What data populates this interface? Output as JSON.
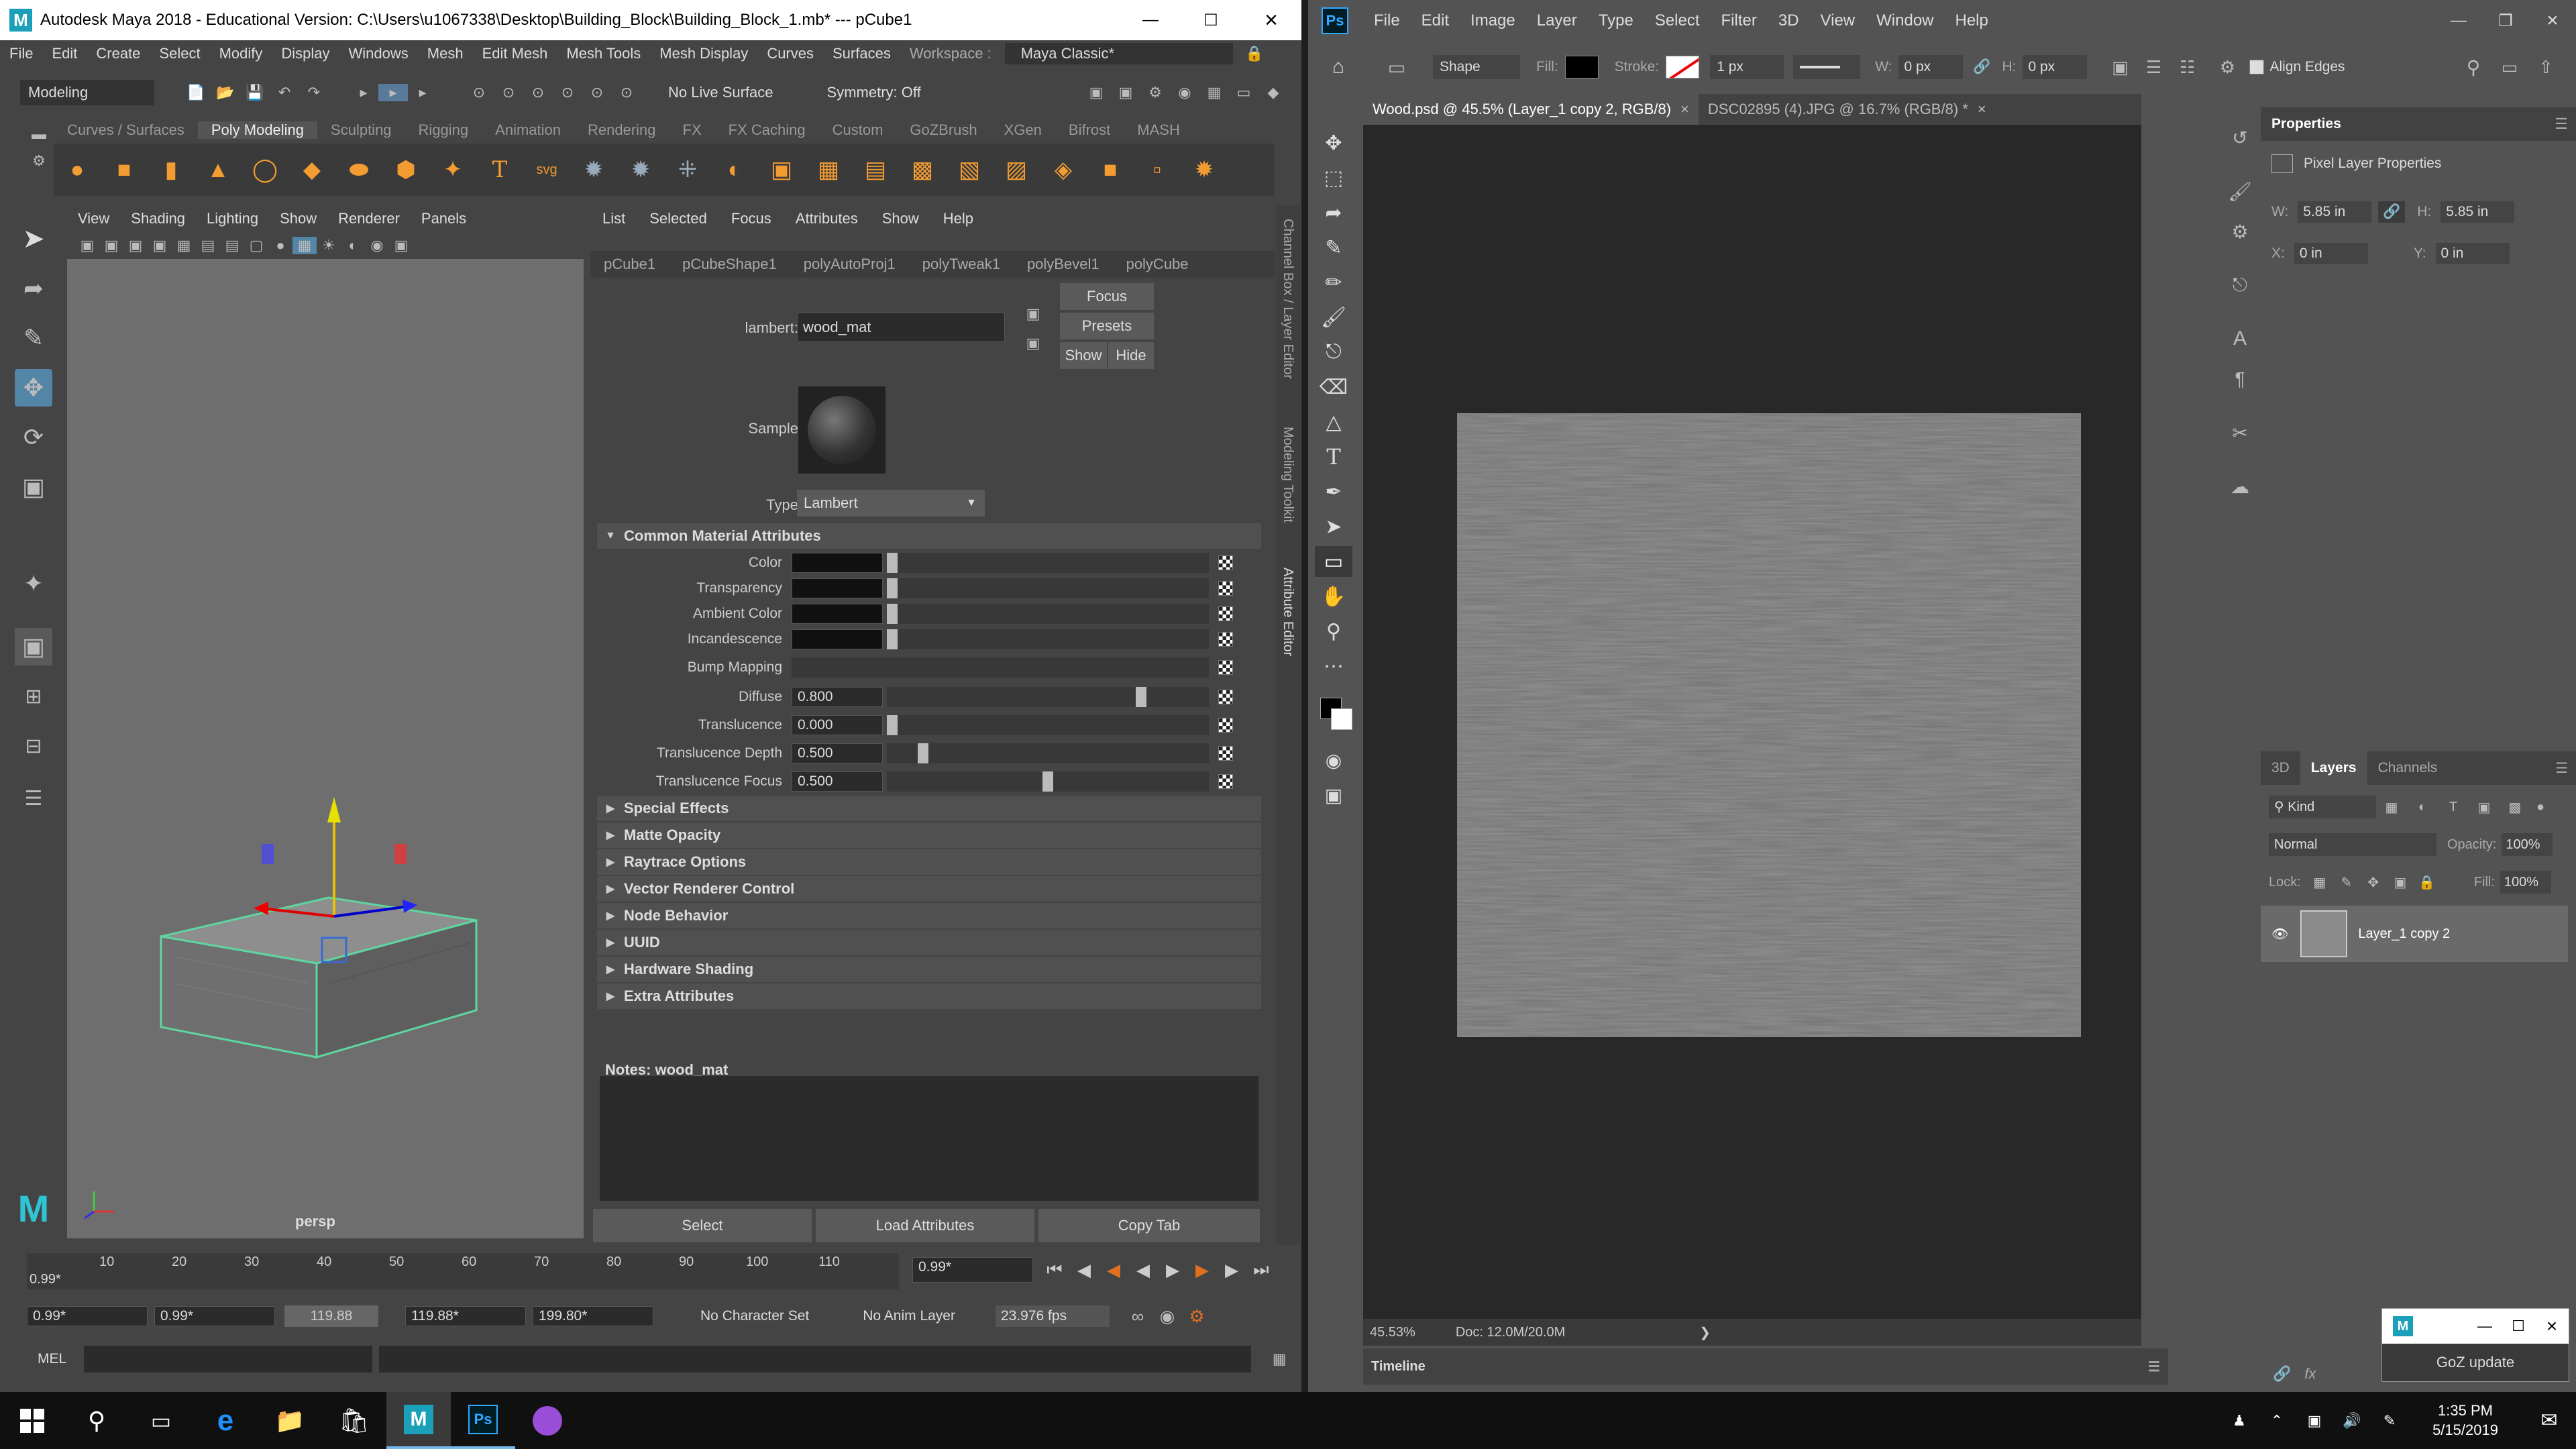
{
  "maya": {
    "title": "Autodesk Maya 2018 - Educational Version: C:\\Users\\u1067338\\Desktop\\Building_Block\\Building_Block_1.mb*   ---   pCube1",
    "menu": [
      "File",
      "Edit",
      "Create",
      "Select",
      "Modify",
      "Display",
      "Windows",
      "Mesh",
      "Edit Mesh",
      "Mesh Tools",
      "Mesh Display",
      "Curves",
      "Surfaces"
    ],
    "workspace_label": "Workspace :",
    "workspace_value": "Maya Classic*",
    "mode": "Modeling",
    "live_surface": "No Live Surface",
    "symmetry": "Symmetry: Off",
    "shelf_tabs": [
      "Curves / Surfaces",
      "Poly Modeling",
      "Sculpting",
      "Rigging",
      "Animation",
      "Rendering",
      "FX",
      "FX Caching",
      "Custom",
      "GoZBrush",
      "XGen",
      "Bifrost",
      "MASH"
    ],
    "active_shelf": "Poly Modeling",
    "viewport_menu": [
      "View",
      "Shading",
      "Lighting",
      "Show",
      "Renderer",
      "Panels"
    ],
    "viewport_camera": "persp",
    "attr_menu": [
      "List",
      "Selected",
      "Focus",
      "Attributes",
      "Show",
      "Help"
    ],
    "node_tabs": [
      "pCube1",
      "pCubeShape1",
      "polyAutoProj1",
      "polyTweak1",
      "polyBevel1",
      "polyCube"
    ],
    "material_type_label": "lambert:",
    "material_name": "wood_mat",
    "buttons": {
      "focus": "Focus",
      "presets": "Presets",
      "show": "Show",
      "hide": "Hide"
    },
    "sample_label": "Sample",
    "type_label": "Type",
    "type_value": "Lambert",
    "common_section": "Common Material Attributes",
    "attributes": [
      {
        "label": "Color",
        "kind": "swatch"
      },
      {
        "label": "Transparency",
        "kind": "swatch"
      },
      {
        "label": "Ambient Color",
        "kind": "swatch"
      },
      {
        "label": "Incandescence",
        "kind": "swatch"
      },
      {
        "label": "Bump Mapping",
        "kind": "bar"
      },
      {
        "label": "Diffuse",
        "kind": "num",
        "value": "0.800",
        "level": 0.8
      },
      {
        "label": "Translucence",
        "kind": "num",
        "value": "0.000",
        "level": 0.0
      },
      {
        "label": "Translucence Depth",
        "kind": "num",
        "value": "0.500",
        "level": 0.1
      },
      {
        "label": "Translucence Focus",
        "kind": "num",
        "value": "0.500",
        "level": 0.5
      }
    ],
    "collapsed_sections": [
      "Special Effects",
      "Matte Opacity",
      "Raytrace Options",
      "Vector Renderer Control",
      "Node Behavior",
      "UUID",
      "Hardware Shading",
      "Extra Attributes"
    ],
    "notes_label": "Notes:  wood_mat",
    "bottom_buttons": [
      "Select",
      "Load Attributes",
      "Copy Tab"
    ],
    "side_tabs": [
      "Channel Box / Layer Editor",
      "Modeling Toolkit",
      "Attribute Editor"
    ],
    "timeline_ticks": [
      "10",
      "20",
      "30",
      "40",
      "50",
      "60",
      "70",
      "80",
      "90",
      "100",
      "110"
    ],
    "current_frame": "0.99*",
    "playback_frame": "0.99*",
    "range": {
      "start": "0.99*",
      "inner_start": "0.99*",
      "inner_end": "119.88",
      "end": "119.88*",
      "anim_end": "199.80*"
    },
    "character_set": "No Character Set",
    "anim_layer": "No Anim Layer",
    "fps": "23.976 fps",
    "cmd_label": "MEL"
  },
  "ps": {
    "menu": [
      "File",
      "Edit",
      "Image",
      "Layer",
      "Type",
      "Select",
      "Filter",
      "3D",
      "View",
      "Window",
      "Help"
    ],
    "logo": "Ps",
    "shape_mode": "Shape",
    "fill_label": "Fill:",
    "stroke_label": "Stroke:",
    "stroke_width": "1 px",
    "w_label": "W:",
    "w_value": "0 px",
    "h_label": "H:",
    "h_value": "0 px",
    "align_edges": "Align Edges",
    "doc_tabs": [
      {
        "label": "Wood.psd @ 45.5% (Layer_1 copy 2, RGB/8)",
        "active": true
      },
      {
        "label": "DSC02895 (4).JPG @ 16.7% (RGB/8) *",
        "active": false
      }
    ],
    "zoom": "45.53%",
    "doc_info": "Doc: 12.0M/20.0M",
    "timeline_label": "Timeline",
    "properties_title": "Properties",
    "properties_sub": "Pixel Layer Properties",
    "prop_w_label": "W:",
    "prop_w": "5.85 in",
    "prop_h_label": "H:",
    "prop_h": "5.85 in",
    "prop_x_label": "X:",
    "prop_x": "0 in",
    "prop_y_label": "Y:",
    "prop_y": "0 in",
    "layer_tabs": [
      "3D",
      "Layers",
      "Channels"
    ],
    "active_layer_tab": "Layers",
    "kind_filter": "Kind",
    "blend_mode": "Normal",
    "opacity_label": "Opacity:",
    "opacity": "100%",
    "lock_label": "Lock:",
    "fill_pct_label": "Fill:",
    "fill_pct": "100%",
    "layer_name": "Layer_1 copy 2",
    "goz_label": "GoZ update"
  },
  "taskbar": {
    "time": "1:35 PM",
    "date": "5/15/2019"
  },
  "colors": {
    "maya_bg": "#444444",
    "viewport_bg": "#6e6e6e",
    "shelf_orange": "#f39c32",
    "ps_bg": "#535353",
    "ps_canvas": "#282828",
    "wood_gray": "#8a8a8a",
    "taskbar": "#101010"
  }
}
